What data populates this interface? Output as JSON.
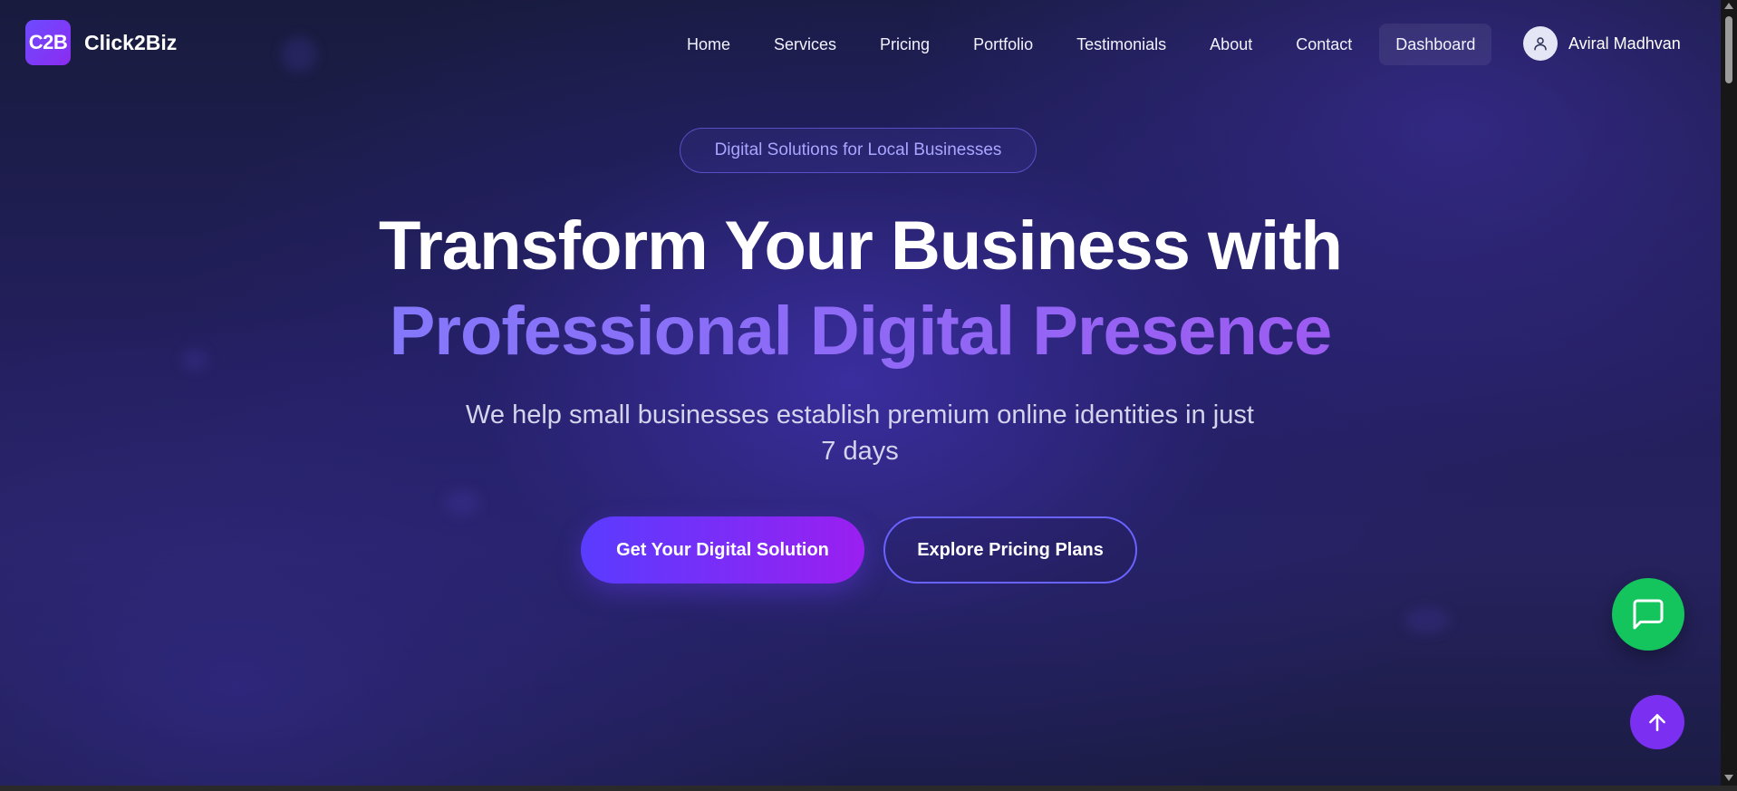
{
  "brand": {
    "logo_badge": "C2B",
    "name": "Click2Biz"
  },
  "nav": {
    "items": [
      {
        "label": "Home"
      },
      {
        "label": "Services"
      },
      {
        "label": "Pricing"
      },
      {
        "label": "Portfolio"
      },
      {
        "label": "Testimonials"
      },
      {
        "label": "About"
      },
      {
        "label": "Contact"
      },
      {
        "label": "Dashboard"
      }
    ],
    "user": {
      "name": "Aviral Madhvan",
      "avatar_icon": "user-icon"
    }
  },
  "hero": {
    "pill": "Digital Solutions for Local Businesses",
    "headline_line1": "Transform Your Business with",
    "headline_line2": "Professional Digital Presence",
    "subheading": "We help small businesses establish premium online identities in just 7 days",
    "primary_cta": "Get Your Digital Solution",
    "secondary_cta": "Explore Pricing Plans"
  },
  "floating": {
    "chat_icon": "message-square-icon",
    "scroll_top_icon": "arrow-up-icon"
  },
  "colors": {
    "accent_purple": "#7b2ff0",
    "gradient_start": "#5a3cff",
    "gradient_end": "#9a1ff0",
    "chat_green": "#14c45c",
    "headline_gradient_start": "#7c83ff",
    "headline_gradient_end": "#a950ee"
  }
}
